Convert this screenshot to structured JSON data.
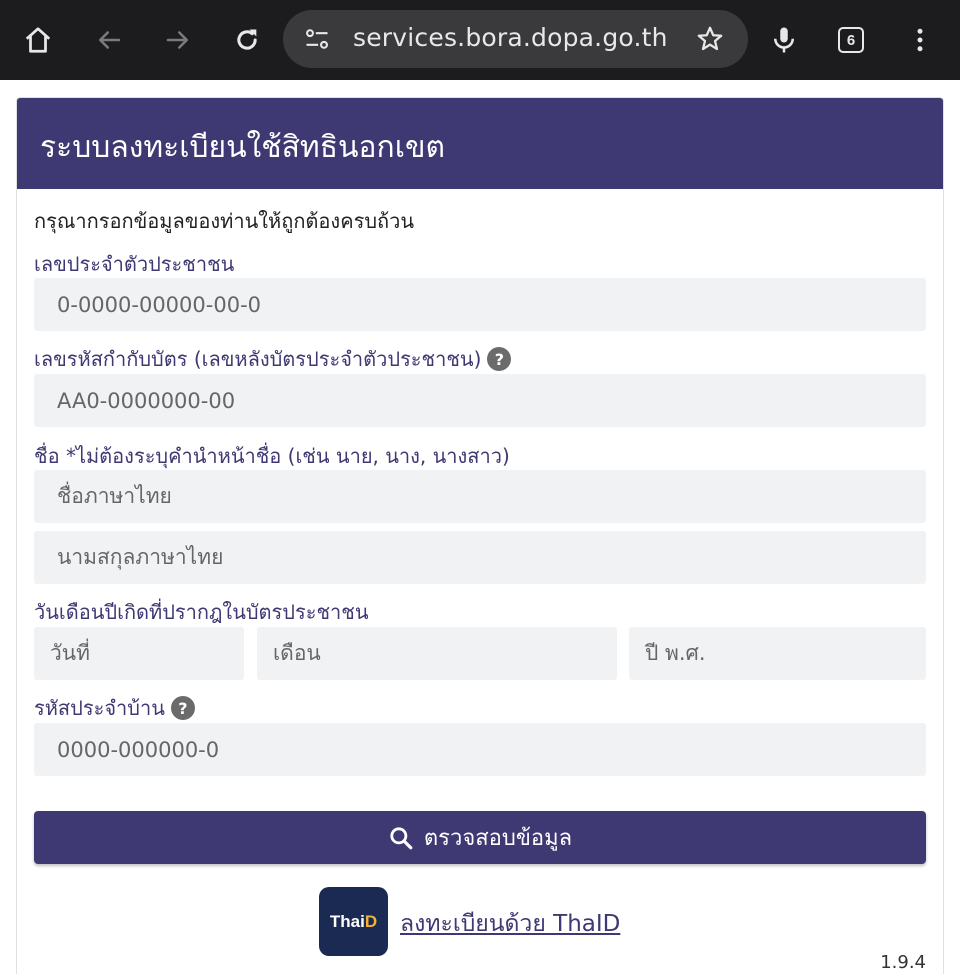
{
  "browser": {
    "url": "services.bora.dopa.go.th",
    "tab_count": "6"
  },
  "form": {
    "title": "ระบบลงทะเบียนใช้สิทธินอกเขต",
    "instruction": "กรุณากรอกข้อมูลของท่านให้ถูกต้องครบถ้วน",
    "id_label": "เลขประจำตัวประชาชน",
    "id_placeholder": "0-0000-00000-00-0",
    "laser_label": "เลขรหัสกำกับบัตร (เลขหลังบัตรประจำตัวประชาชน)",
    "laser_placeholder": "AA0-0000000-00",
    "name_label": "ชื่อ *ไม่ต้องระบุคำนำหน้าชื่อ (เช่น นาย, นาง, นางสาว)",
    "firstname_placeholder": "ชื่อภาษาไทย",
    "lastname_placeholder": "นามสกุลภาษาไทย",
    "dob_label": "วันเดือนปีเกิดที่ปรากฎในบัตรประชาชน",
    "day_placeholder": "วันที่",
    "month_placeholder": "เดือน",
    "year_placeholder": "ปี พ.ศ.",
    "house_label": "รหัสประจำบ้าน",
    "house_placeholder": "0000-000000-0",
    "help_glyph": "?",
    "submit_label": "ตรวจสอบข้อมูล",
    "thaid_link": "ลงทะเบียนด้วย ThaID",
    "thaid_logo_text_a": "Thai",
    "thaid_logo_text_b": "D",
    "version": "1.9.4"
  },
  "colors": {
    "brand": "#3e3873",
    "field_bg": "#f1f2f3",
    "chrome_bg": "#1c1c1e"
  }
}
